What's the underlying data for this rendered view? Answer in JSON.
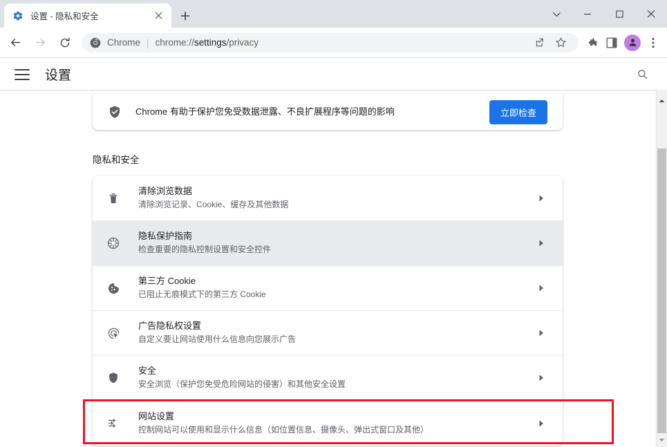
{
  "window": {
    "controls": {
      "tab_search": "tab-search-chevron",
      "minimize": "minimize",
      "maximize": "maximize",
      "close": "close"
    }
  },
  "tab": {
    "favicon": "settings-gear-icon",
    "title": "设置 - 隐私和安全",
    "close_label": "×",
    "new_tab_label": "+"
  },
  "toolbar": {
    "back": "back-arrow",
    "forward": "forward-arrow",
    "reload": "reload",
    "omnibox": {
      "brand": "Chrome",
      "separator": "|",
      "url_prefix": "chrome://",
      "url_strong": "settings",
      "url_suffix": "/privacy"
    },
    "share": "share-icon",
    "bookmark": "star-icon",
    "extensions": "puzzle-icon",
    "side_panel": "side-panel-icon",
    "profile": "profile-avatar",
    "menu": "three-dot-menu"
  },
  "settings_header": {
    "menu_label": "hamburger-menu",
    "title": "设置",
    "search_label": "search-icon"
  },
  "safety_check": {
    "icon": "shield-check-icon",
    "text": "Chrome 有助于保护您免受数据泄露、不良扩展程序等问题的影响",
    "button_label": "立即检查",
    "button_color": "#1a73e8"
  },
  "section": {
    "title": "隐私和安全"
  },
  "rows": [
    {
      "icon": "trash-icon",
      "title": "清除浏览数据",
      "subtitle": "清除浏览记录、Cookie、缓存及其他数据",
      "highlighted": false
    },
    {
      "icon": "privacy-guide-icon",
      "title": "隐私保护指南",
      "subtitle": "检查重要的隐私控制设置和安全控件",
      "highlighted": true
    },
    {
      "icon": "cookie-icon",
      "title": "第三方 Cookie",
      "subtitle": "已阻止无痕模式下的第三方 Cookie",
      "highlighted": false
    },
    {
      "icon": "ad-privacy-icon",
      "title": "广告隐私权设置",
      "subtitle": "自定义要让网站使用什么信息向您展示广告",
      "highlighted": false
    },
    {
      "icon": "shield-icon",
      "title": "安全",
      "subtitle": "安全浏览（保护您免受危险网站的侵害）和其他安全设置",
      "highlighted": false
    },
    {
      "icon": "tune-sliders-icon",
      "title": "网站设置",
      "subtitle": "控制网站可以使用和显示什么信息（如位置信息、摄像头、弹出式窗口及其他）",
      "highlighted": false
    }
  ],
  "annotation": {
    "color": "#ee1122",
    "target": "网站设置"
  },
  "scrollbar": {
    "up": "scroll-up-arrow",
    "down": "scroll-down-arrow"
  }
}
